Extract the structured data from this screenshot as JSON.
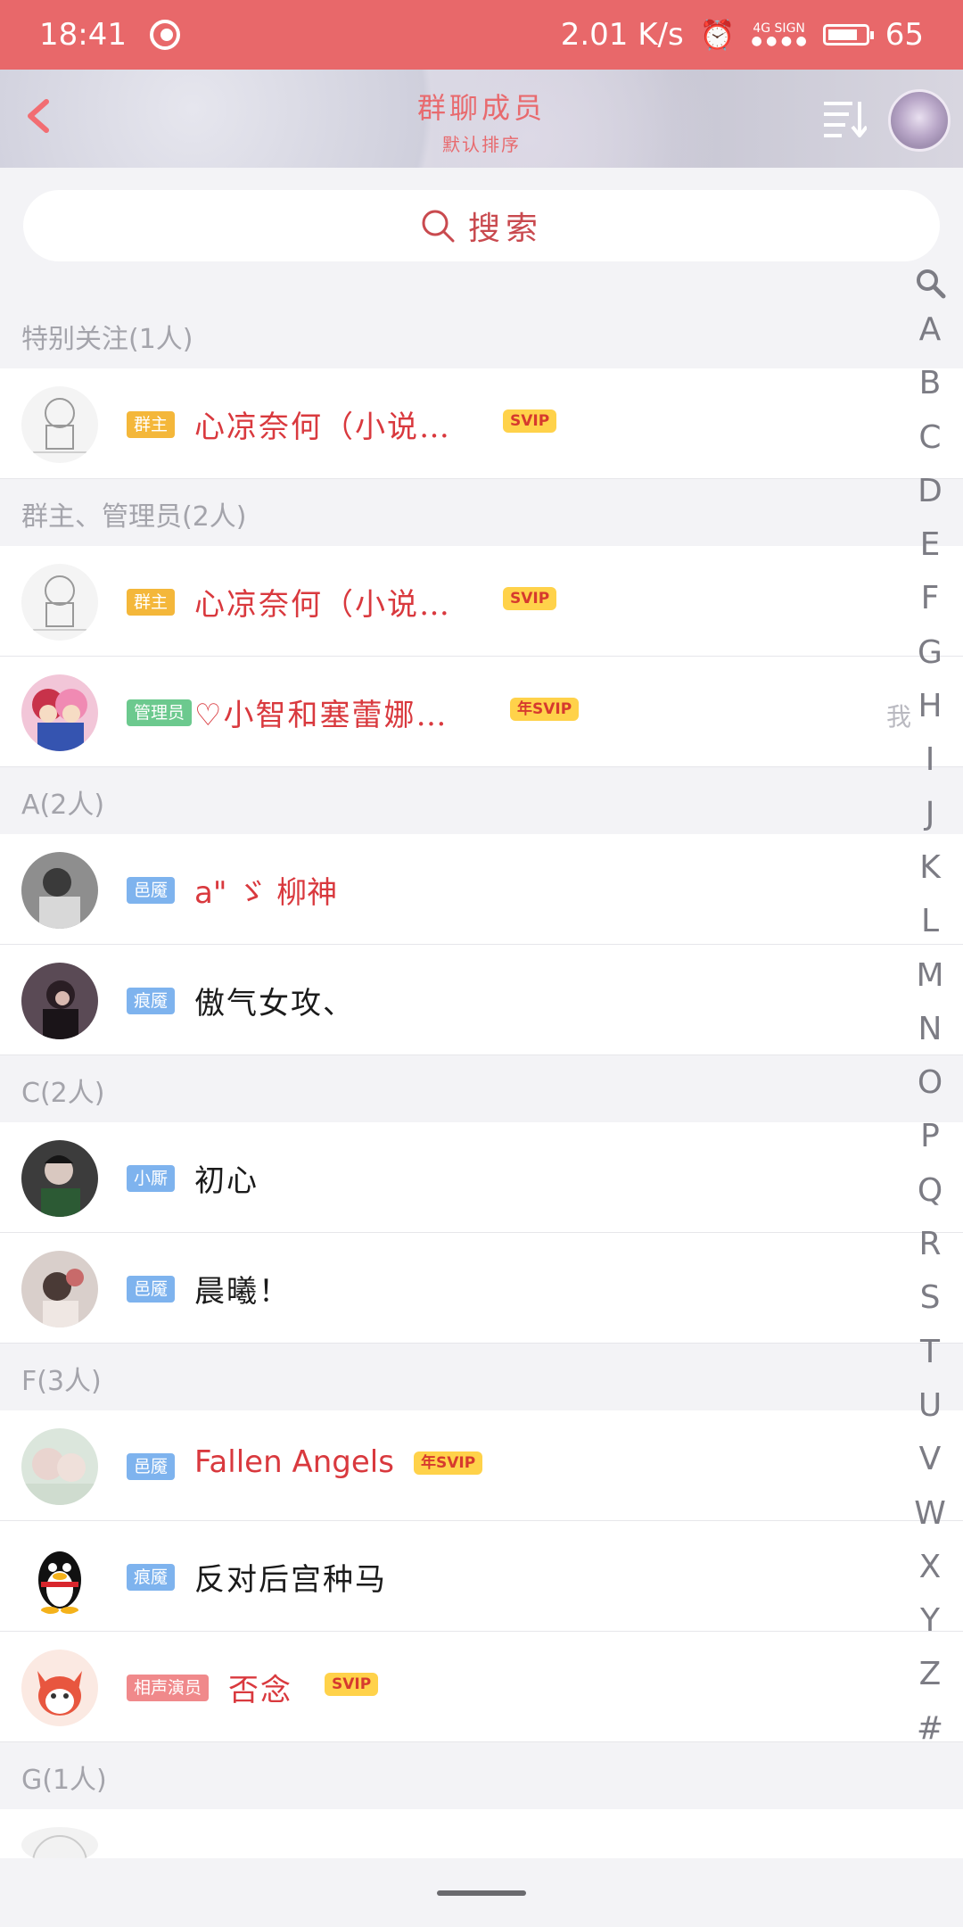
{
  "status_bar": {
    "time": "18:41",
    "network_speed": "2.01 K/s",
    "signal_label": "4G SIGN",
    "battery": "65"
  },
  "header": {
    "title": "群聊成员",
    "subtitle": "默认排序"
  },
  "search": {
    "placeholder": "搜索"
  },
  "sections": [
    {
      "title": "特别关注(1人)",
      "members": [
        {
          "badge": "群主",
          "badge_color": "#f4b73a",
          "name": "心凉奈何（小说…",
          "name_color": "red",
          "vip": "SVIP",
          "avatar": "sketch"
        }
      ]
    },
    {
      "title": "群主、管理员(2人)",
      "members": [
        {
          "badge": "群主",
          "badge_color": "#f4b73a",
          "name": "心凉奈何（小说…",
          "name_color": "red",
          "vip": "SVIP",
          "avatar": "sketch"
        },
        {
          "badge": "管理员",
          "badge_color": "#6cc98e",
          "name": "♡小智和塞蕾娜…",
          "name_color": "red",
          "vip": "年SVIP",
          "avatar": "anime",
          "me": "我"
        }
      ]
    },
    {
      "title": "A(2人)",
      "members": [
        {
          "badge": "邑魇",
          "badge_color": "#7eb3ee",
          "name": "a\" ゞ 柳神",
          "name_color": "red",
          "vip": "",
          "avatar": "photo1"
        },
        {
          "badge": "痕魇",
          "badge_color": "#7eb3ee",
          "name": "傲气女攻、",
          "name_color": "black",
          "vip": "",
          "avatar": "photo2"
        }
      ]
    },
    {
      "title": "C(2人)",
      "members": [
        {
          "badge": "小厮",
          "badge_color": "#7eb3ee",
          "name": "初心",
          "name_color": "black",
          "vip": "",
          "avatar": "photo3"
        },
        {
          "badge": "邑魇",
          "badge_color": "#7eb3ee",
          "name": "晨曦！",
          "name_color": "black",
          "vip": "",
          "avatar": "photo4"
        }
      ]
    },
    {
      "title": "F(3人)",
      "members": [
        {
          "badge": "邑魇",
          "badge_color": "#7eb3ee",
          "name": "Fallen Angels",
          "name_color": "red",
          "vip": "年SVIP",
          "avatar": "photo5"
        },
        {
          "badge": "痕魇",
          "badge_color": "#7eb3ee",
          "name": "反对后宫种马",
          "name_color": "black",
          "vip": "",
          "avatar": "penguin"
        },
        {
          "badge": "相声演员",
          "badge_color": "#f0898b",
          "name": "否念",
          "name_color": "red",
          "vip": "SVIP",
          "avatar": "cat"
        }
      ]
    },
    {
      "title": "G(1人)",
      "members": []
    }
  ],
  "index_letters": [
    "A",
    "B",
    "C",
    "D",
    "E",
    "F",
    "G",
    "H",
    "I",
    "J",
    "K",
    "L",
    "M",
    "N",
    "O",
    "P",
    "Q",
    "R",
    "S",
    "T",
    "U",
    "V",
    "W",
    "X",
    "Y",
    "Z",
    "#"
  ]
}
